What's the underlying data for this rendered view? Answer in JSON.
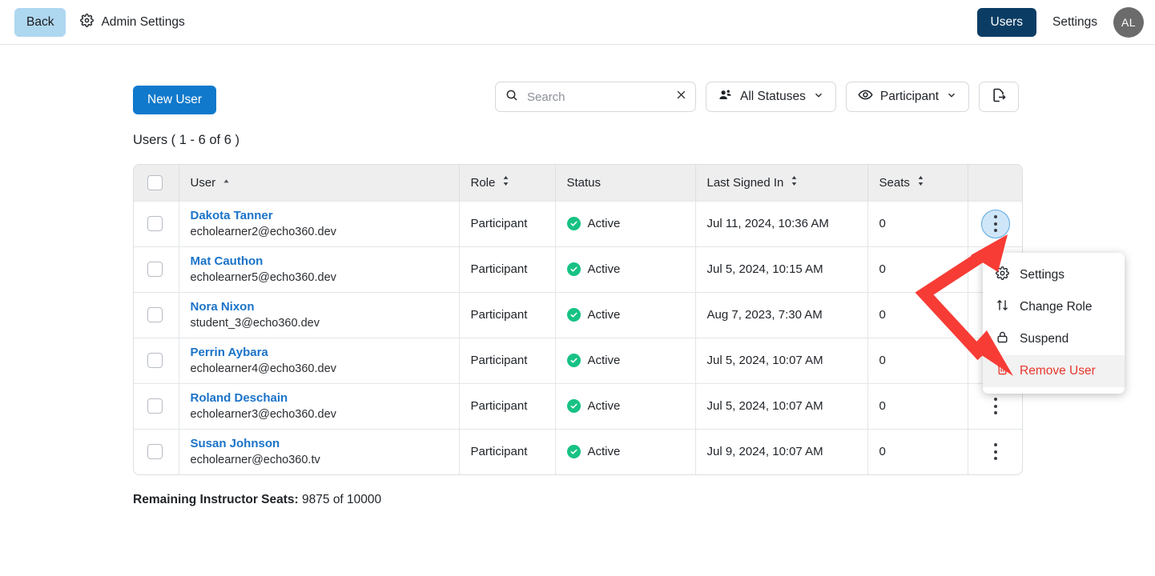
{
  "topbar": {
    "back_label": "Back",
    "admin_label": "Admin Settings",
    "gear_icon": "gear-icon",
    "users_tab": "Users",
    "settings_tab": "Settings",
    "avatar_initials": "AL"
  },
  "toolbar": {
    "new_user_label": "New User",
    "search_placeholder": "Search",
    "search_value": "",
    "search_icon": "search-icon",
    "clear_icon": "close-icon",
    "status_filter_label": "All Statuses",
    "status_filter_icon": "people-icon",
    "role_filter_label": "Participant",
    "role_filter_icon": "eye-icon",
    "export_icon": "export-icon",
    "chevron_icon": "chevron-down-icon"
  },
  "list": {
    "count_label": "Users ( 1 - 6 of 6 )",
    "footer_label_bold": "Remaining Instructor Seats:",
    "footer_label_value": " 9875 of 10000"
  },
  "table": {
    "columns": [
      {
        "label": "User",
        "sort": "asc"
      },
      {
        "label": "Role",
        "sort": "none"
      },
      {
        "label": "Status",
        "sort": null
      },
      {
        "label": "Last Signed In",
        "sort": "none"
      },
      {
        "label": "Seats",
        "sort": "none"
      }
    ],
    "rows": [
      {
        "name": "Dakota Tanner",
        "email": "echolearner2@echo360.dev",
        "role": "Participant",
        "status": "Active",
        "last_signed_in": "Jul 11, 2024, 10:36 AM",
        "seats": "0"
      },
      {
        "name": "Mat Cauthon",
        "email": "echolearner5@echo360.dev",
        "role": "Participant",
        "status": "Active",
        "last_signed_in": "Jul 5, 2024, 10:15 AM",
        "seats": "0"
      },
      {
        "name": "Nora Nixon",
        "email": "student_3@echo360.dev",
        "role": "Participant",
        "status": "Active",
        "last_signed_in": "Aug 7, 2023, 7:30 AM",
        "seats": "0"
      },
      {
        "name": "Perrin Aybara",
        "email": "echolearner4@echo360.dev",
        "role": "Participant",
        "status": "Active",
        "last_signed_in": "Jul 5, 2024, 10:07 AM",
        "seats": "0"
      },
      {
        "name": "Roland Deschain",
        "email": "echolearner3@echo360.dev",
        "role": "Participant",
        "status": "Active",
        "last_signed_in": "Jul 5, 2024, 10:07 AM",
        "seats": "0"
      },
      {
        "name": "Susan Johnson",
        "email": "echolearner@echo360.tv",
        "role": "Participant",
        "status": "Active",
        "last_signed_in": "Jul 9, 2024, 10:07 AM",
        "seats": "0"
      }
    ]
  },
  "row_menu": {
    "items": [
      {
        "label": "Settings",
        "icon": "gear-icon"
      },
      {
        "label": "Change Role",
        "icon": "swap-arrows-icon"
      },
      {
        "label": "Suspend",
        "icon": "lock-icon"
      },
      {
        "label": "Remove User",
        "icon": "trash-icon"
      }
    ]
  },
  "colors": {
    "primary_blue": "#1079cc",
    "navy": "#0b3d64",
    "back_blue": "#aed7f0",
    "link_blue": "#1a73c8",
    "active_green": "#17c284",
    "danger_red": "#e8372c",
    "annotation_red": "#f73c35"
  }
}
